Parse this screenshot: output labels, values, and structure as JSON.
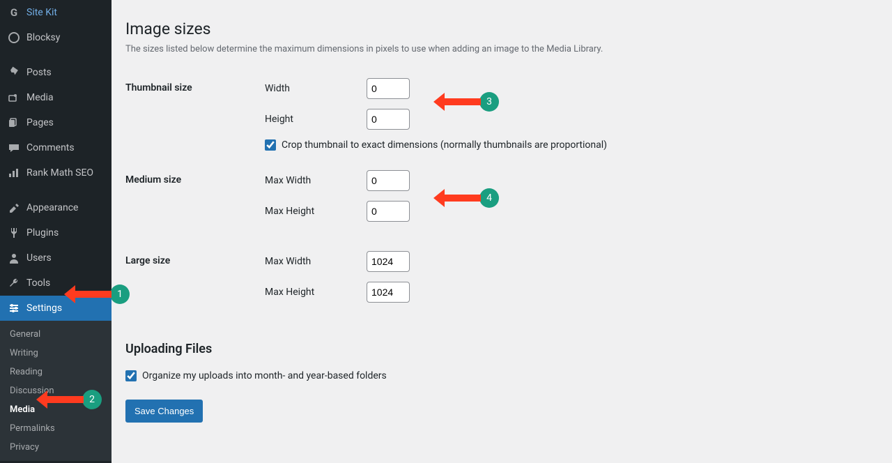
{
  "sidebar": {
    "items": [
      {
        "label": "Site Kit",
        "icon": "G",
        "name": "sidebar-item-sitekit"
      },
      {
        "label": "Blocksy",
        "icon": "circle",
        "name": "sidebar-item-blocksy"
      },
      {
        "sep": true
      },
      {
        "label": "Posts",
        "icon": "pin",
        "name": "sidebar-item-posts"
      },
      {
        "label": "Media",
        "icon": "media",
        "name": "sidebar-item-media"
      },
      {
        "label": "Pages",
        "icon": "page",
        "name": "sidebar-item-pages"
      },
      {
        "label": "Comments",
        "icon": "comment",
        "name": "sidebar-item-comments"
      },
      {
        "label": "Rank Math SEO",
        "icon": "chart",
        "name": "sidebar-item-rankmath"
      },
      {
        "sep": true
      },
      {
        "label": "Appearance",
        "icon": "brush",
        "name": "sidebar-item-appearance"
      },
      {
        "label": "Plugins",
        "icon": "plug",
        "name": "sidebar-item-plugins"
      },
      {
        "label": "Users",
        "icon": "user",
        "name": "sidebar-item-users"
      },
      {
        "label": "Tools",
        "icon": "wrench",
        "name": "sidebar-item-tools"
      },
      {
        "label": "Settings",
        "icon": "sliders",
        "name": "sidebar-item-settings",
        "active": true
      }
    ],
    "submenu": {
      "items": [
        {
          "label": "General",
          "name": "submenu-general"
        },
        {
          "label": "Writing",
          "name": "submenu-writing"
        },
        {
          "label": "Reading",
          "name": "submenu-reading"
        },
        {
          "label": "Discussion",
          "name": "submenu-discussion"
        },
        {
          "label": "Media",
          "name": "submenu-media",
          "current": true
        },
        {
          "label": "Permalinks",
          "name": "submenu-permalinks"
        },
        {
          "label": "Privacy",
          "name": "submenu-privacy"
        }
      ]
    }
  },
  "page": {
    "heading": "Image sizes",
    "description": "The sizes listed below determine the maximum dimensions in pixels to use when adding an image to the Media Library.",
    "thumbnail": {
      "title": "Thumbnail size",
      "width_label": "Width",
      "width_value": "0",
      "height_label": "Height",
      "height_value": "0",
      "crop_label": "Crop thumbnail to exact dimensions (normally thumbnails are proportional)"
    },
    "medium": {
      "title": "Medium size",
      "width_label": "Max Width",
      "width_value": "0",
      "height_label": "Max Height",
      "height_value": "0"
    },
    "large": {
      "title": "Large size",
      "width_label": "Max Width",
      "width_value": "1024",
      "height_label": "Max Height",
      "height_value": "1024"
    },
    "upload": {
      "heading": "Uploading Files",
      "organize_label": "Organize my uploads into month- and year-based folders"
    },
    "save_label": "Save Changes"
  },
  "annotations": {
    "a1": "1",
    "a2": "2",
    "a3": "3",
    "a4": "4"
  }
}
